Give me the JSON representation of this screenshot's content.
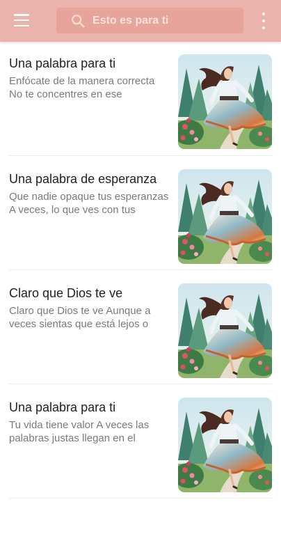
{
  "app_bar": {
    "menu_icon": "hamburger-menu-icon",
    "search_icon": "search-icon",
    "search_placeholder": "Esto es para ti",
    "more_icon": "more-vert-icon",
    "color": "#eab4ac"
  },
  "posts": [
    {
      "title": "Una palabra para ti",
      "snippet": "Enfócate de la manera correcta\nNo te concentres en ese"
    },
    {
      "title": "Una palabra de esperanza",
      "snippet": "Que nadie opaque tus esperanzas\nA veces, lo que ves con tus"
    },
    {
      "title": "Claro que Dios te ve",
      "snippet": "Claro que Dios te ve Aunque a veces sientas que está lejos o"
    },
    {
      "title": "Una palabra para ti",
      "snippet": "Tu vida tiene valor A veces las palabras justas llegan en el"
    }
  ]
}
